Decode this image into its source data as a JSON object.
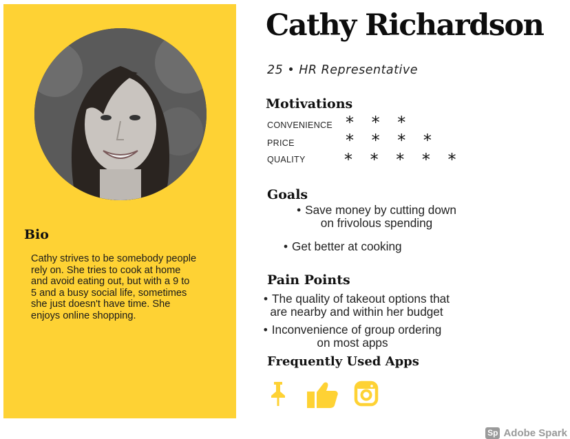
{
  "persona": {
    "name": "Cathy Richardson",
    "subtitle": "25 • HR Representative"
  },
  "bio": {
    "heading": "Bio",
    "lines": [
      "Cathy strives to be somebody people",
      "rely on. She tries to cook at home",
      "and avoid eating out, but with a 9 to",
      "5 and a busy social life, sometimes",
      "she just doesn't have time. She",
      "enjoys online shopping."
    ]
  },
  "motivations": {
    "heading": "Motivations",
    "items": [
      {
        "label": "CONVENIENCE",
        "stars": "* * *",
        "rating": 3
      },
      {
        "label": "PRICE",
        "stars": "* * * *",
        "rating": 4
      },
      {
        "label": "QUALITY",
        "stars": "* * * * *",
        "rating": 5
      }
    ]
  },
  "goals": {
    "heading": "Goals",
    "items": [
      {
        "line1": "Save money by cutting down",
        "line2": "on frivolous spending"
      },
      {
        "line1": "Get better at cooking",
        "line2": ""
      }
    ]
  },
  "pain_points": {
    "heading": "Pain Points",
    "items": [
      {
        "line1": "The quality of takeout options that",
        "line2": "are nearby and within her budget"
      },
      {
        "line1": "Inconvenience of group ordering",
        "line2": "on most apps"
      }
    ]
  },
  "apps": {
    "heading": "Frequently Used Apps",
    "icons": [
      "pin-icon",
      "thumbs-up-icon",
      "instagram-icon"
    ],
    "color": "#fed234"
  },
  "watermark": {
    "badge": "Sp",
    "text": "Adobe Spark"
  },
  "colors": {
    "panel": "#fed234",
    "text": "#111111"
  }
}
